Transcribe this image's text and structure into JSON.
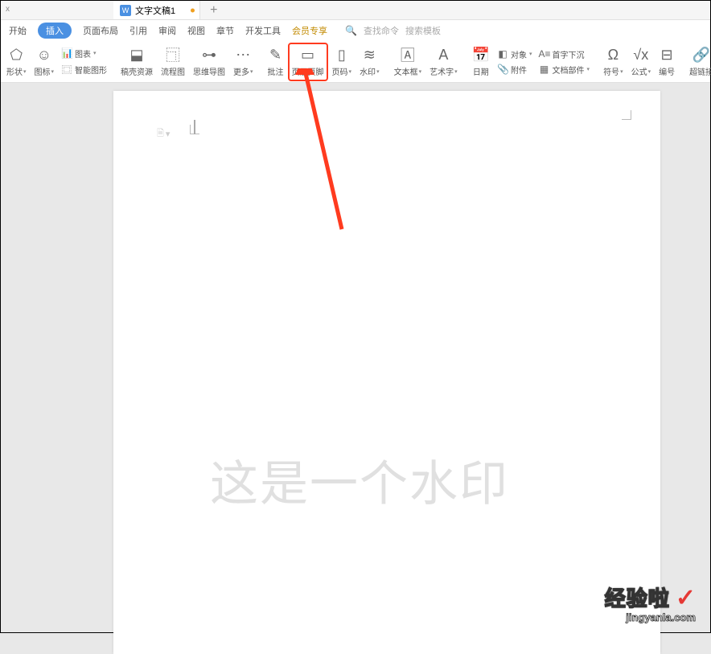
{
  "tabs": {
    "prev_suffix": "x",
    "doc_title": "文字文稿1",
    "add": "+"
  },
  "menu": {
    "start": "开始",
    "insert": "插入",
    "page_layout": "页面布局",
    "reference": "引用",
    "review": "审阅",
    "view": "视图",
    "chapter": "章节",
    "dev_tools": "开发工具",
    "member": "会员专享"
  },
  "search": {
    "cmd_placeholder": "查找命令",
    "tmpl_placeholder": "搜索模板"
  },
  "ribbon": {
    "shape": "形状",
    "icon": "图标",
    "chart": "图表",
    "smart_shape": "智能图形",
    "template_res": "稿壳资源",
    "flowchart": "流程图",
    "mindmap": "思维导图",
    "more": "更多",
    "comment": "批注",
    "header_footer": "页眉页脚",
    "page_num": "页码",
    "watermark": "水印",
    "textbox": "文本框",
    "wordart": "艺术字",
    "date": "日期",
    "object": "对象",
    "attachment": "附件",
    "drop_cap": "首字下沉",
    "doc_parts": "文档部件",
    "symbol": "符号",
    "formula": "公式",
    "number": "编号",
    "hyperlink": "超链接"
  },
  "document": {
    "watermark_text": "这是一个水印",
    "header_dropdown": "▾"
  },
  "logo": {
    "line1": "经验啦",
    "check": "✓",
    "line2": "jingyanla.com"
  }
}
